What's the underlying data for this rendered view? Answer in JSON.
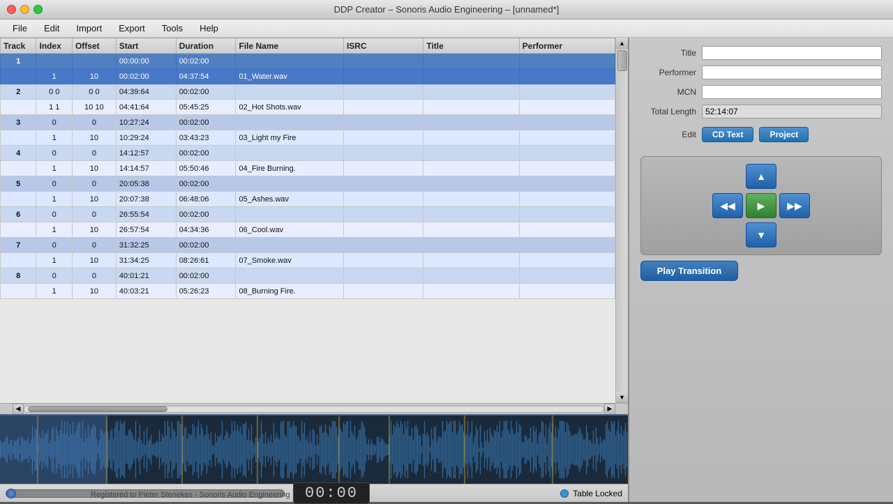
{
  "window": {
    "title": "DDP Creator – Sonoris Audio Engineering – [unnamed*]"
  },
  "menubar": {
    "items": [
      "File",
      "Edit",
      "Import",
      "Export",
      "Tools",
      "Help"
    ]
  },
  "table": {
    "columns": [
      "Track",
      "Index",
      "Offset",
      "Start",
      "Duration",
      "File Name",
      "ISRC",
      "Title",
      "Performer"
    ],
    "rows": [
      {
        "track": "1",
        "index": "",
        "offset": "",
        "start": "00:00:00",
        "duration": "00:02:00",
        "filename": "",
        "isrc": "",
        "title": "",
        "performer": "",
        "type": "pre",
        "selected": true
      },
      {
        "track": "",
        "index": "1",
        "offset": "10",
        "start": "00:02:00",
        "duration": "04:37:54",
        "filename": "01_Water.wav",
        "isrc": "",
        "title": "",
        "performer": "",
        "type": "audio",
        "selected": true
      },
      {
        "track": "2",
        "index": "0 0",
        "offset": "0 0",
        "start": "04:39:64",
        "duration": "00:02:00",
        "filename": "",
        "isrc": "",
        "title": "",
        "performer": "",
        "type": "pre2"
      },
      {
        "track": "",
        "index": "1 1",
        "offset": "10 10",
        "start": "04:41:64",
        "duration": "05:45:25",
        "filename": "02_Hot Shots.wav",
        "isrc": "",
        "title": "",
        "performer": "",
        "type": "audio2"
      },
      {
        "track": "3",
        "index": "0",
        "offset": "0",
        "start": "10:27:24",
        "duration": "00:02:00",
        "filename": "",
        "isrc": "",
        "title": "",
        "performer": "",
        "type": "pre"
      },
      {
        "track": "",
        "index": "1",
        "offset": "10",
        "start": "10:29:24",
        "duration": "03:43:23",
        "filename": "03_Light my Fire",
        "isrc": "",
        "title": "",
        "performer": "",
        "type": "audio"
      },
      {
        "track": "4",
        "index": "0",
        "offset": "0",
        "start": "14:12:57",
        "duration": "00:02:00",
        "filename": "",
        "isrc": "",
        "title": "",
        "performer": "",
        "type": "pre2"
      },
      {
        "track": "",
        "index": "1",
        "offset": "10",
        "start": "14:14:57",
        "duration": "05:50:46",
        "filename": "04_Fire Burning.",
        "isrc": "",
        "title": "",
        "performer": "",
        "type": "audio2"
      },
      {
        "track": "5",
        "index": "0",
        "offset": "0",
        "start": "20:05:38",
        "duration": "00:02:00",
        "filename": "",
        "isrc": "",
        "title": "",
        "performer": "",
        "type": "pre"
      },
      {
        "track": "",
        "index": "1",
        "offset": "10",
        "start": "20:07:38",
        "duration": "06:48:06",
        "filename": "05_Ashes.wav",
        "isrc": "",
        "title": "",
        "performer": "",
        "type": "audio"
      },
      {
        "track": "6",
        "index": "0",
        "offset": "0",
        "start": "26:55:54",
        "duration": "00:02:00",
        "filename": "",
        "isrc": "",
        "title": "",
        "performer": "",
        "type": "pre2"
      },
      {
        "track": "",
        "index": "1",
        "offset": "10",
        "start": "26:57:54",
        "duration": "04:34:36",
        "filename": "06_Cool.wav",
        "isrc": "",
        "title": "",
        "performer": "",
        "type": "audio2"
      },
      {
        "track": "7",
        "index": "0",
        "offset": "0",
        "start": "31:32:25",
        "duration": "00:02:00",
        "filename": "",
        "isrc": "",
        "title": "",
        "performer": "",
        "type": "pre"
      },
      {
        "track": "",
        "index": "1",
        "offset": "10",
        "start": "31:34:25",
        "duration": "08:26:61",
        "filename": "07_Smoke.wav",
        "isrc": "",
        "title": "",
        "performer": "",
        "type": "audio"
      },
      {
        "track": "8",
        "index": "0",
        "offset": "0",
        "start": "40:01:21",
        "duration": "00:02:00",
        "filename": "",
        "isrc": "",
        "title": "",
        "performer": "",
        "type": "pre2"
      },
      {
        "track": "",
        "index": "1",
        "offset": "10",
        "start": "40:03:21",
        "duration": "05:26:23",
        "filename": "08_Burning Fire.",
        "isrc": "",
        "title": "",
        "performer": "",
        "type": "audio2"
      }
    ]
  },
  "sidebar": {
    "title_label": "Title",
    "performer_label": "Performer",
    "mcn_label": "MCN",
    "total_length_label": "Total Length",
    "total_length_value": "52:14:07",
    "edit_label": "Edit",
    "cd_text_btn": "CD Text",
    "project_btn": "Project",
    "play_transition_btn": "Play Transition",
    "table_locked": "Table Locked"
  },
  "transport": {
    "up_btn": "▲",
    "left_btn": "◀◀",
    "play_btn": "▶",
    "right_btn": "▶▶",
    "down_btn": "▼"
  },
  "timecode": {
    "value": "00:00"
  },
  "registration": {
    "text": "Registered to Pieter Stenekes - Sonoris Audio Engineering"
  }
}
